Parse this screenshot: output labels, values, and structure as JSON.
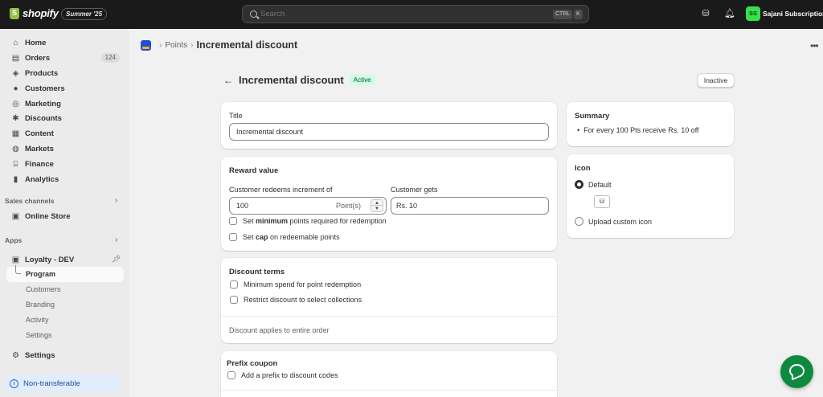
{
  "topbar": {
    "logo_text": "shopify",
    "edition": "Summer '25",
    "search_placeholder": "Search",
    "shortcut_ctrl": "CTRL",
    "shortcut_k": "K",
    "avatar_initials": "SS",
    "store_name": "Sajani Subscriptions"
  },
  "sidebar": {
    "items": [
      {
        "label": "Home",
        "icon": "home-icon"
      },
      {
        "label": "Orders",
        "icon": "inbox-icon",
        "badge": "124"
      },
      {
        "label": "Products",
        "icon": "tag-icon"
      },
      {
        "label": "Customers",
        "icon": "person-icon"
      },
      {
        "label": "Marketing",
        "icon": "target-icon"
      },
      {
        "label": "Discounts",
        "icon": "discount-icon"
      },
      {
        "label": "Content",
        "icon": "content-icon"
      },
      {
        "label": "Markets",
        "icon": "globe-icon"
      },
      {
        "label": "Finance",
        "icon": "bank-icon"
      },
      {
        "label": "Analytics",
        "icon": "chart-icon"
      }
    ],
    "sales_channels_label": "Sales channels",
    "online_store": "Online Store",
    "apps_label": "Apps",
    "app_name": "Loyalty - DEV",
    "app_subitems": [
      "Program",
      "Customers",
      "Branding",
      "Activity",
      "Settings"
    ],
    "settings": "Settings",
    "non_transferable": "Non-transferable"
  },
  "breadcrumb": {
    "parent": "Points",
    "current": "Incremental discount"
  },
  "page": {
    "title": "Incremental discount",
    "status": "Active",
    "inactive_button": "Inactive"
  },
  "title_card": {
    "label": "Title",
    "value": "Incremental discount"
  },
  "reward_card": {
    "heading": "Reward value",
    "redeem_label": "Customer redeems increment of",
    "redeem_value": "100",
    "redeem_suffix": "Point(s)",
    "gets_label": "Customer gets",
    "gets_value": "Rs. 10",
    "min_check_pre": "Set ",
    "min_check_bold": "minimum",
    "min_check_post": " points required for redemption",
    "cap_check_pre": "Set ",
    "cap_check_bold": "cap",
    "cap_check_post": " on redeemable points"
  },
  "discount_terms": {
    "heading": "Discount terms",
    "min_spend": "Minimum spend for point redemption",
    "restrict": "Restrict discount to select collections",
    "footer": "Discount applies to entire order"
  },
  "prefix_card": {
    "heading": "Prefix coupon",
    "add_prefix": "Add a prefix to discount codes"
  },
  "summary": {
    "heading": "Summary",
    "bullet": "For every 100 Pts receive Rs. 10 off"
  },
  "icon_card": {
    "heading": "Icon",
    "default_option": "Default",
    "upload_option": "Upload custom icon"
  }
}
